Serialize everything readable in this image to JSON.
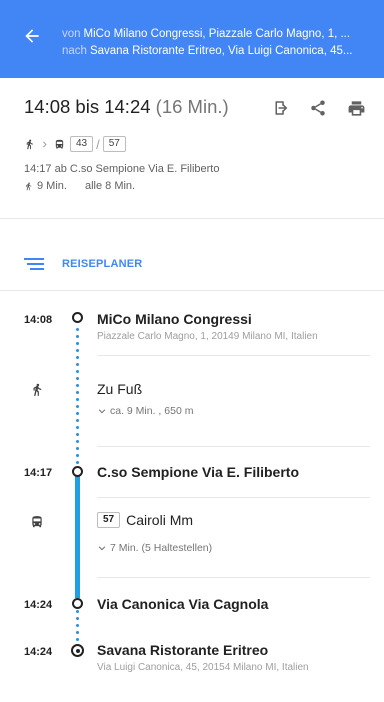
{
  "header": {
    "from_prefix": "von",
    "from_value": "MiCo Milano Congressi, Piazzale Carlo Magno, 1, ...",
    "to_prefix": "nach",
    "to_value": "Savana Ristorante Eritreo, Via Luigi Canonica, 45..."
  },
  "summary": {
    "time_range": "14:08 bis 14:24",
    "duration": "(16 Min.)",
    "route_lines": [
      "43",
      "57"
    ],
    "departure": "14:17 ab C.so Sempione Via E. Filiberto",
    "walk_time": "9 Min.",
    "frequency": "alle 8 Min."
  },
  "planner": {
    "label": "REISEPLANER"
  },
  "timeline": {
    "stop1": {
      "time": "14:08",
      "name": "MiCo Milano Congressi",
      "address": "Piazzale Carlo Magno, 1, 20149 Milano MI, Italien"
    },
    "walk": {
      "label": "Zu Fuß",
      "detail": "ca. 9 Min. , 650 m"
    },
    "stop2": {
      "time": "14:17",
      "name": "C.so Sempione Via E. Filiberto"
    },
    "bus": {
      "line": "57",
      "destination": "Cairoli Mm",
      "detail": "7 Min. (5 Haltestellen)"
    },
    "stop3": {
      "time": "14:24",
      "name": "Via Canonica Via Cagnola"
    },
    "stop4": {
      "time": "14:24",
      "name": "Savana Ristorante Eritreo",
      "address": "Via Luigi Canonica, 45, 20154 Milano MI, Italien"
    }
  },
  "colors": {
    "header_bg": "#4285f4",
    "accent": "#4285f4",
    "transit_line": "#1fa0e5"
  },
  "icons": [
    "arrow-back-icon",
    "exit-icon",
    "share-icon",
    "print-icon",
    "walk-icon",
    "bus-icon",
    "menu-lines-icon",
    "chevron-down-icon"
  ]
}
